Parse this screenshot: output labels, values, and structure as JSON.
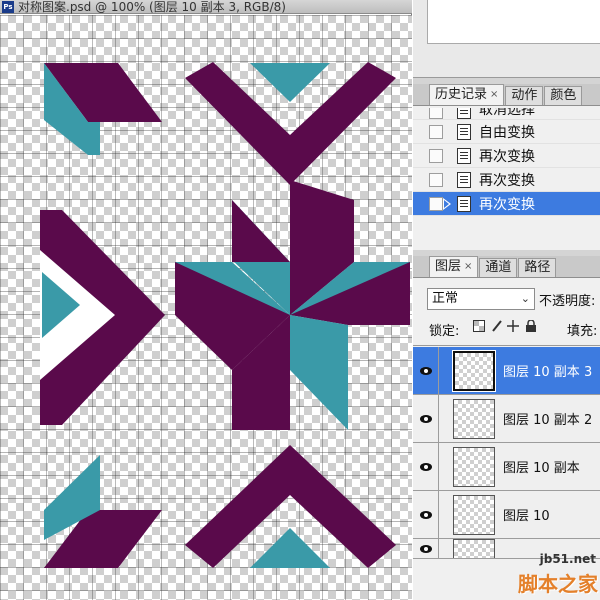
{
  "document": {
    "app_icon_text": "Ps",
    "title": "对称图案.psd @ 100% (图层 10 副本 3, RGB/8)",
    "colors": {
      "purple": "#5a0a4b",
      "teal": "#3a9aa8"
    }
  },
  "history_panel": {
    "tabs": [
      {
        "label": "历史记录",
        "close": "×",
        "active": true
      },
      {
        "label": "动作",
        "close": "",
        "active": false
      },
      {
        "label": "颜色",
        "close": "",
        "active": false
      }
    ],
    "items": [
      {
        "label": "取消选择",
        "selected": false
      },
      {
        "label": "自由变换",
        "selected": false
      },
      {
        "label": "再次变换",
        "selected": false
      },
      {
        "label": "再次变换",
        "selected": false
      },
      {
        "label": "再次变换",
        "selected": true
      }
    ],
    "selection_color": "#3d7be0"
  },
  "layers_panel": {
    "tabs": [
      {
        "label": "图层",
        "close": "×",
        "active": true
      },
      {
        "label": "通道",
        "close": "",
        "active": false
      },
      {
        "label": "路径",
        "close": "",
        "active": false
      }
    ],
    "blend_mode": "正常",
    "opacity_label": "不透明度:",
    "lock_label": "锁定:",
    "fill_label": "填充:",
    "layers": [
      {
        "name": "图层 10 副本 3",
        "visible": true,
        "selected": true
      },
      {
        "name": "图层 10 副本 2",
        "visible": true,
        "selected": false
      },
      {
        "name": "图层 10 副本",
        "visible": true,
        "selected": false
      },
      {
        "name": "图层 10",
        "visible": true,
        "selected": false
      },
      {
        "name": "",
        "visible": true,
        "selected": false
      }
    ]
  },
  "watermark": {
    "url": "jb51.net",
    "brand": "脚本之家"
  }
}
